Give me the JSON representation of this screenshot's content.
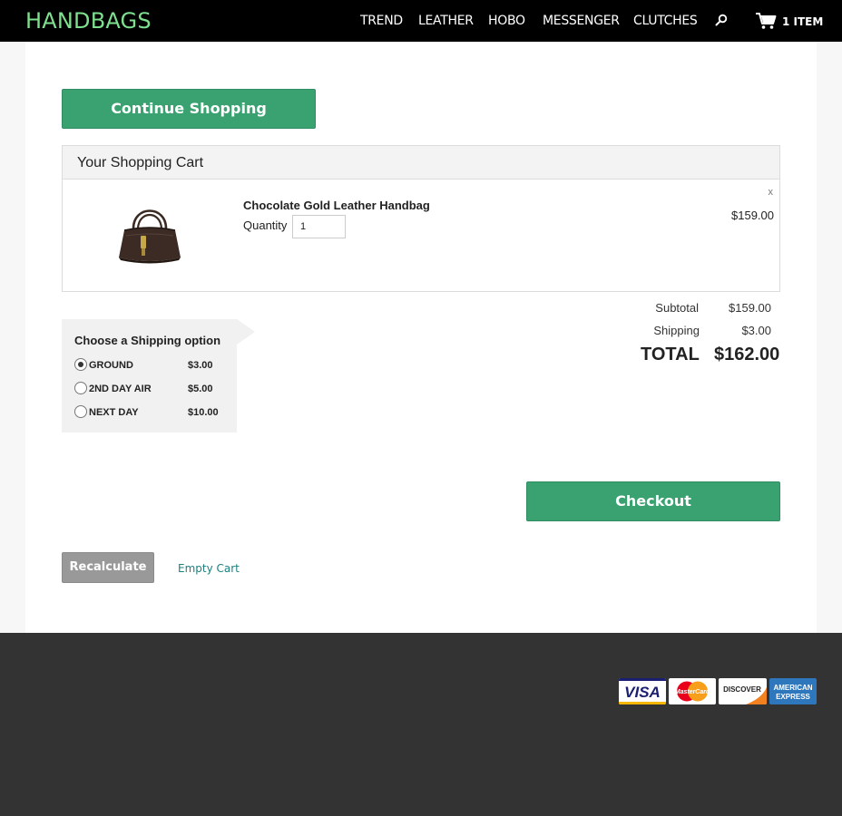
{
  "header": {
    "logo": "HANDBAGS",
    "nav": [
      "TREND",
      "LEATHER",
      "HOBO",
      "MESSENGER",
      "CLUTCHES"
    ],
    "cart_count": "1 ITEM",
    "logo_color": "#7ee08e"
  },
  "cart": {
    "continue_label": "Continue Shopping",
    "heading": "Your Shopping Cart",
    "item": {
      "name": "Chocolate Gold Leather Handbag",
      "quantity_label": "Quantity",
      "quantity": "1",
      "price": "$159.00",
      "remove": "x"
    },
    "subtotal_label": "Subtotal",
    "subtotal": "$159.00",
    "shipping_label": "Shipping",
    "shipping": "$3.00",
    "total_label": "TOTAL",
    "total": "$162.00",
    "checkout_label": "Checkout",
    "recalculate_label": "Recalculate",
    "empty_label": "Empty Cart"
  },
  "shipping": {
    "title": "Choose a Shipping option",
    "options": [
      {
        "name": "GROUND",
        "price": "$3.00",
        "selected": true
      },
      {
        "name": "2ND DAY AIR",
        "price": "$5.00",
        "selected": false
      },
      {
        "name": "NEXT DAY",
        "price": "$10.00",
        "selected": false
      }
    ]
  },
  "footer": {
    "cards": {
      "visa": "VISA",
      "mastercard": "MasterCard",
      "discover": "DISCOVER",
      "amex_line1": "AMERICAN",
      "amex_line2": "EXPRESS"
    }
  },
  "colors": {
    "accent": "#3aa271",
    "link": "#1d7f7f",
    "footer_bg": "#333333"
  }
}
